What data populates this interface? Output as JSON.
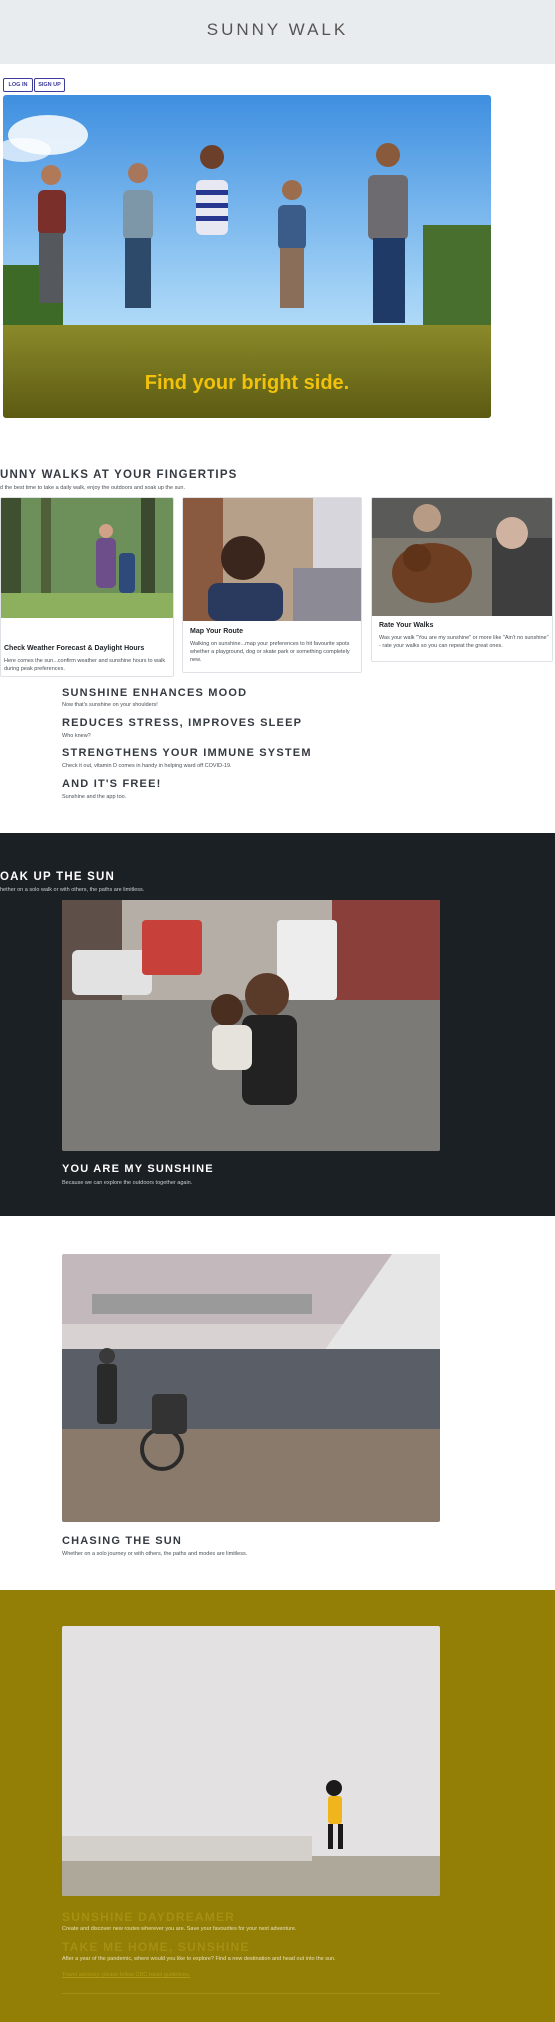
{
  "header": {
    "title": "SUNNY WALK"
  },
  "auth": {
    "login": "LOG IN",
    "signup": "SIGN UP"
  },
  "hero": {
    "tagline": "Find your bright side."
  },
  "features": {
    "heading": "UNNY WALKS AT YOUR FINGERTIPS",
    "subheading": "d the best time to take a daily walk, enjoy the outdoors and soak up the sun.",
    "cards": [
      {
        "title": "Check Weather Forecast & Daylight Hours",
        "text": "Here comes the sun...confirm weather and sunshine hours to walk during peak preferences."
      },
      {
        "title": "Map Your Route",
        "text": "Walking on sunshine...map your preferences to hit favourite spots whether a playground, dog or skate park or something completely new."
      },
      {
        "title": "Rate Your Walks",
        "text": "Was your walk \"You are my sunshine\" or more like \"Ain't no sunshine\" - rate your walks so you can repeat the great ones."
      }
    ]
  },
  "benefits": [
    {
      "title": "SUNSHINE ENHANCES MOOD",
      "text": "Now that's sunshine on your shoulders!"
    },
    {
      "title": "REDUCES STRESS, IMPROVES SLEEP",
      "text": "Who knew?"
    },
    {
      "title": "STRENGTHENS YOUR IMMUNE SYSTEM",
      "text": "Check it out, vitamin D comes in handy in helping ward off COVID-19."
    },
    {
      "title": "AND IT'S FREE!",
      "text": "Sunshine and the app too."
    }
  ],
  "soak": {
    "heading": "OAK UP THE SUN",
    "subheading": "hether on a solo walk or with others, the paths are limitless.",
    "card_title": "YOU ARE MY SUNSHINE",
    "card_text": "Because we can explore the outdoors together again."
  },
  "chasing": {
    "title": "CHASING THE SUN",
    "text": "Whether on a solo journey or with others, the paths and modes are limitless."
  },
  "footer": {
    "title1": "SUNSHINE DAYDREAMER",
    "text1": "Create and discover new routes wherever you are. Save your favourites for your next adventure.",
    "title2": "TAKE ME HOME, SUNSHINE",
    "text2": "After a year of the pandemic, where would you like to explore? Find a new destination and head out into the sun.",
    "link": "Travel advisory: please follow CDC travel guidelines."
  },
  "icons": {
    "hero": "hero-photo",
    "card1": "forest-walk-photo",
    "card2": "smiling-man-photo",
    "card3": "dog-photo"
  }
}
